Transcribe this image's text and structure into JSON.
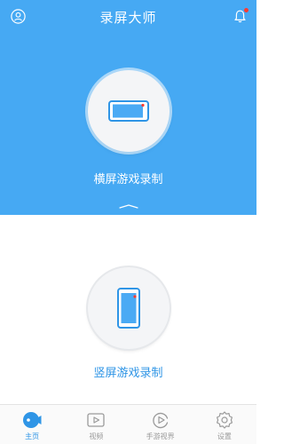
{
  "app": {
    "title": "录屏大师"
  },
  "modes": {
    "landscape_label": "横屏游戏录制",
    "portrait_label": "竖屏游戏录制"
  },
  "tabs": [
    {
      "label": "主页",
      "icon": "home-camera-icon",
      "active": true
    },
    {
      "label": "视频",
      "icon": "video-play-icon",
      "active": false
    },
    {
      "label": "手游视界",
      "icon": "game-view-icon",
      "active": false
    },
    {
      "label": "设置",
      "icon": "gear-icon",
      "active": false
    }
  ],
  "colors": {
    "accent": "#46a9f3",
    "active_tab": "#2f95e6",
    "inactive_tab": "#9a9a9a",
    "record_dot": "#ff3b30"
  }
}
